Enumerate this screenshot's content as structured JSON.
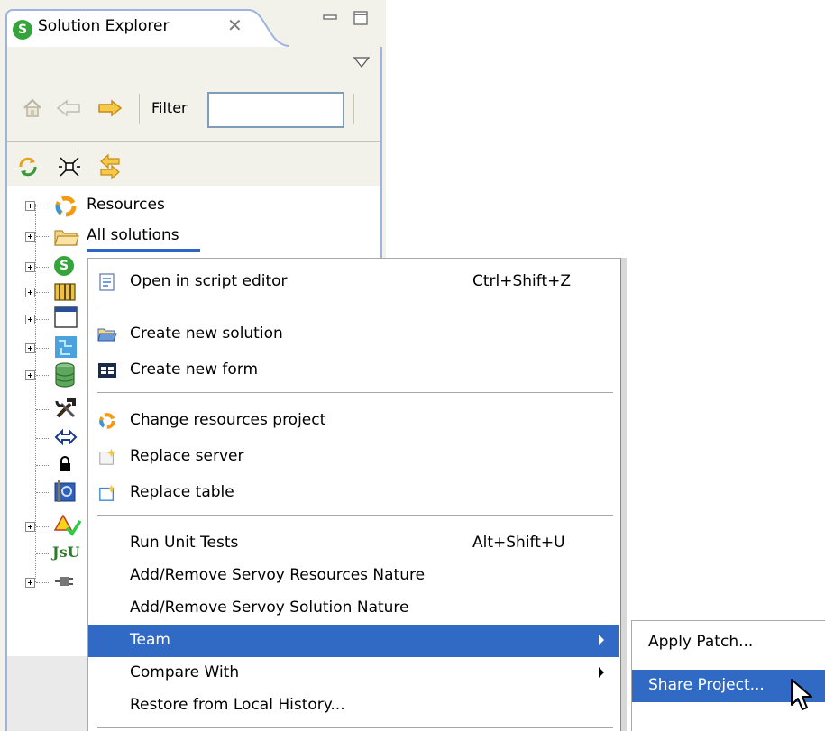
{
  "view": {
    "title": "Solution Explorer",
    "tab_icon_letter": "S",
    "close_glyph": "✕",
    "filter_label": "Filter",
    "filter_value": ""
  },
  "tree": {
    "items": [
      {
        "label": "Resources",
        "icon": "resources-icon",
        "expandable": true
      },
      {
        "label": "All solutions",
        "icon": "folder-icon",
        "expandable": true
      },
      {
        "label": "",
        "icon": "solution-icon",
        "expandable": true
      },
      {
        "label": "",
        "icon": "plugins-icon",
        "expandable": true
      },
      {
        "label": "",
        "icon": "window-icon",
        "expandable": true
      },
      {
        "label": "",
        "icon": "beans-icon",
        "expandable": true
      },
      {
        "label": "",
        "icon": "database-icon",
        "expandable": true
      },
      {
        "label": "",
        "icon": "tools-icon",
        "expandable": false
      },
      {
        "label": "",
        "icon": "arrows-icon",
        "expandable": false
      },
      {
        "label": "",
        "icon": "lock-icon",
        "expandable": false
      },
      {
        "label": "",
        "icon": "i18n-icon",
        "expandable": false
      },
      {
        "label": "",
        "icon": "warnings-icon",
        "expandable": true
      },
      {
        "label": "JsU",
        "icon": "jsunit-icon",
        "expandable": false
      },
      {
        "label": "",
        "icon": "plug-icon",
        "expandable": true
      }
    ]
  },
  "context_menu": {
    "items": [
      {
        "label": "Open in script editor",
        "shortcut": "Ctrl+Shift+Z",
        "icon": "script-editor-icon"
      },
      {
        "label": "Create new solution",
        "shortcut": "",
        "icon": "open-folder-icon"
      },
      {
        "label": "Create new form",
        "shortcut": "",
        "icon": "form-icon"
      },
      {
        "label": "Change resources project",
        "shortcut": "",
        "icon": "resources-icon"
      },
      {
        "label": "Replace server",
        "shortcut": "",
        "icon": "replace-server-icon"
      },
      {
        "label": "Replace table",
        "shortcut": "",
        "icon": "replace-table-icon"
      },
      {
        "label": "Run Unit Tests",
        "shortcut": "Alt+Shift+U",
        "icon": ""
      },
      {
        "label": "Add/Remove Servoy Resources Nature",
        "shortcut": "",
        "icon": ""
      },
      {
        "label": "Add/Remove Servoy Solution Nature",
        "shortcut": "",
        "icon": ""
      },
      {
        "label": "Team",
        "shortcut": "",
        "icon": "",
        "submenu": true,
        "highlighted": true
      },
      {
        "label": "Compare With",
        "shortcut": "",
        "icon": "",
        "submenu": true
      },
      {
        "label": "Restore from Local History...",
        "shortcut": "",
        "icon": ""
      }
    ]
  },
  "submenu": {
    "items": [
      {
        "label": "Apply Patch...",
        "highlighted": false
      },
      {
        "label": "Share Project...",
        "highlighted": true
      }
    ]
  },
  "colors": {
    "selection": "#316ac5",
    "view_border": "#9db4e0",
    "view_background": "#f2f1ea"
  }
}
